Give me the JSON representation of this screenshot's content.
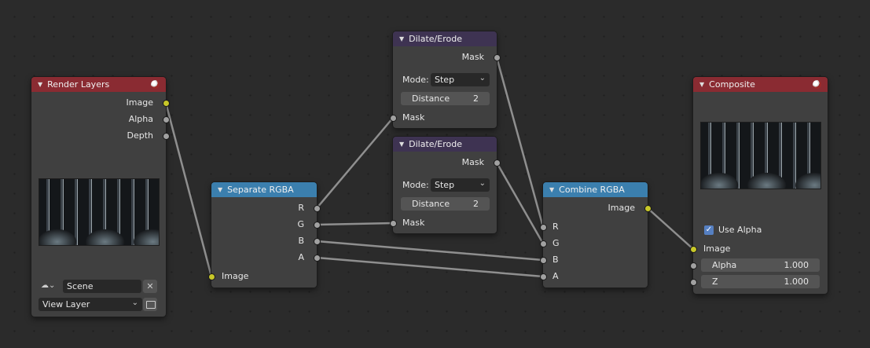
{
  "nodes": {
    "render_layers": {
      "title": "Render Layers",
      "outputs": [
        "Image",
        "Alpha",
        "Depth"
      ],
      "scene": "Scene",
      "view_layer": "View Layer"
    },
    "separate_rgba": {
      "title": "Separate RGBA",
      "outputs": [
        "R",
        "G",
        "B",
        "A"
      ],
      "input": "Image"
    },
    "dilate_erode_1": {
      "title": "Dilate/Erode",
      "output": "Mask",
      "mode_label": "Mode:",
      "mode_value": "Step",
      "distance_label": "Distance",
      "distance_value": "2",
      "input": "Mask"
    },
    "dilate_erode_2": {
      "title": "Dilate/Erode",
      "output": "Mask",
      "mode_label": "Mode:",
      "mode_value": "Step",
      "distance_label": "Distance",
      "distance_value": "2",
      "input": "Mask"
    },
    "combine_rgba": {
      "title": "Combine RGBA",
      "output": "Image",
      "inputs": [
        "R",
        "G",
        "B",
        "A"
      ]
    },
    "composite": {
      "title": "Composite",
      "use_alpha_label": "Use Alpha",
      "use_alpha_checked": true,
      "input_image": "Image",
      "alpha_label": "Alpha",
      "alpha_value": "1.000",
      "z_label": "Z",
      "z_value": "1.000"
    }
  },
  "colors": {
    "background": "#2b2b2b",
    "node_body": "#404040",
    "header_input_output": "#8a2b32",
    "header_filter": "#3e3352",
    "header_converter": "#3b7fae",
    "socket_color": "#c8c829",
    "socket_value": "#a1a1a1",
    "link": "#8f8f8f"
  }
}
